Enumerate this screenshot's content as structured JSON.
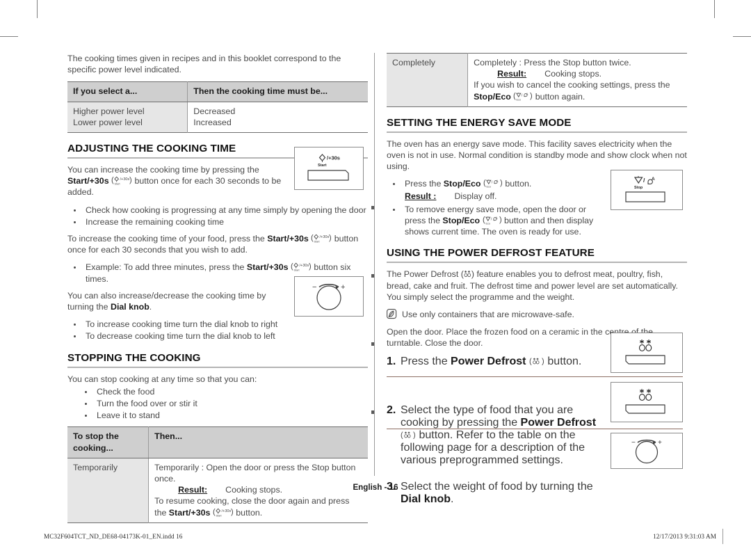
{
  "page": {
    "footer_page_label": "English - 16",
    "footer_file": "MC32F604TCT_ND_DE68-04173K-01_EN.indd   16",
    "footer_timestamp": "12/17/2013   9:31:03 AM"
  },
  "left_column": {
    "intro": "The cooking times given in recipes and in this booklet correspond to the specific power level indicated.",
    "power_table": {
      "headers": [
        "If you select a...",
        "Then the cooking time must be..."
      ],
      "rows": [
        [
          "Higher power level",
          "Decreased"
        ],
        [
          "Lower power level",
          "Increased"
        ]
      ]
    },
    "adjusting": {
      "heading": "ADJUSTING THE COOKING TIME",
      "para1_a": "You can increase the cooking time by pressing the ",
      "para1_b": "Start/+30s",
      "para1_c": " button once for each 30 seconds to be added.",
      "bullets1": [
        "Check how cooking is progressing at any time simply by opening the door",
        "Increase the remaining cooking time"
      ],
      "para2_a": "To increase the cooking time of your food, press the ",
      "para2_b": "Start/+30s",
      "para2_c": " button once for each 30 seconds that you wish to add.",
      "bullet_example_a": "Example: To add three minutes, press the ",
      "bullet_example_b": "Start/+30s",
      "bullet_example_c": " button six times.",
      "para3_a": "You can also increase/decrease the cooking time by turning the ",
      "para3_b": "Dial knob",
      "para3_c": ".",
      "bullets2": [
        "To increase cooking time turn the dial knob to right",
        "To decrease cooking time turn the dial knob to left"
      ]
    },
    "stopping": {
      "heading": "STOPPING THE COOKING",
      "intro": "You can stop cooking at any time so that you can:",
      "bullets": [
        "Check the food",
        "Turn the food over or stir it",
        "Leave it to stand"
      ],
      "table": {
        "headers": [
          "To stop the cooking...",
          "Then..."
        ],
        "row_label": "Temporarily",
        "line1": "Temporarily : Open the door or press the Stop button once.",
        "result_label": "Result:",
        "result_value": "Cooking stops.",
        "line2_a": "To resume cooking, close the door again and press the ",
        "line2_b": "Start/+30s",
        "line2_c": " button."
      }
    }
  },
  "right_column": {
    "completely_table": {
      "row_label": "Completely",
      "line1": "Completely : Press the Stop button twice.",
      "result_label": "Result:",
      "result_value": "Cooking stops.",
      "line2": "If you wish to cancel the cooking settings, press the ",
      "line2_b": "Stop/Eco",
      "line2_c": " button again."
    },
    "energy_save": {
      "heading": "SETTING THE ENERGY SAVE MODE",
      "para1": "The oven has an energy save mode. This facility saves electricity when the oven is not in use. Normal condition is standby mode and show clock when not using.",
      "bullet1_a": "Press the ",
      "bullet1_b": "Stop/Eco",
      "bullet1_c": " button.",
      "result_label": "Result :",
      "result_value": "Display off.",
      "bullet2_a": "To remove energy save mode, open the door or press the ",
      "bullet2_b": "Stop/Eco",
      "bullet2_c": " button and then display shows current time. The oven is ready for use."
    },
    "power_defrost": {
      "heading": "USING THE POWER DEFROST FEATURE",
      "para1_a": "The Power Defrost (",
      "para1_b": ") feature enables you to defrost meat, poultry, fish, bread, cake and fruit. The defrost time and power level are set automatically. You simply select the programme and the weight.",
      "note": "Use only containers that are microwave-safe.",
      "para2": "Open the door. Place the frozen food on a ceramic in the centre of the turntable. Close the door.",
      "steps": [
        {
          "num": "1.",
          "a": "Press the ",
          "b": "Power Defrost",
          "c": " button."
        },
        {
          "num": "2.",
          "a": "Select the type of food that you are cooking by pressing the ",
          "b": "Power Defrost",
          "c": " button. Refer to the table on the following page for a description of the various preprogrammed settings."
        },
        {
          "num": "3.",
          "a": "Select the weight of food by turning the ",
          "b": "Dial knob",
          "c": "."
        }
      ]
    }
  },
  "illustrations": {
    "start_button": {
      "icon_label": "/+30s",
      "sub_label": "Start"
    },
    "stop_button": {
      "icon_label": "/",
      "sub_label": "Stop"
    },
    "dial_knob": {
      "minus": "−",
      "plus": "+"
    },
    "defrost_button": {
      "sub_label": ""
    }
  },
  "colors": {
    "table_header_bg": "#cfcfcf",
    "table_first_col_bg": "#e6e6e6",
    "heading_rule": "#b4b4b4",
    "separator_rule": "#8d6e63",
    "text": "#4a4a4a"
  }
}
